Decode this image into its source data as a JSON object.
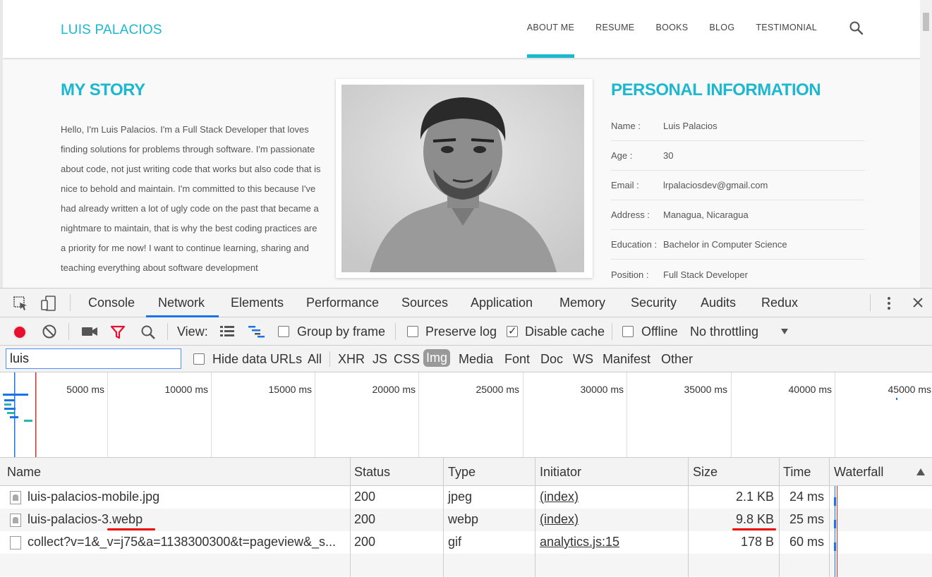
{
  "site": {
    "brand": "LUIS PALACIOS",
    "nav": [
      "ABOUT ME",
      "RESUME",
      "BOOKS",
      "BLOG",
      "TESTIMONIAL"
    ],
    "story_title": "MY STORY",
    "story_text": "Hello, I'm Luis Palacios. I'm a Full Stack Developer that loves finding solutions for problems through software. I'm passionate about code, not just writing code that works but also code that is nice to behold and maintain. I'm committed to this because I've had already written a lot of ugly code on the past that became a nightmare to maintain, that is why the best coding practices are a priority for me now! I want to continue learning, sharing and teaching everything about software development",
    "personal_title": "PERSONAL INFORMATION",
    "personal": [
      {
        "k": "Name :",
        "v": "Luis Palacios"
      },
      {
        "k": "Age :",
        "v": "30"
      },
      {
        "k": "Email :",
        "v": "lrpalaciosdev@gmail.com"
      },
      {
        "k": "Address :",
        "v": "Managua, Nicaragua"
      },
      {
        "k": "Education :",
        "v": "Bachelor in Computer Science"
      },
      {
        "k": "Position :",
        "v": "Full Stack Developer"
      }
    ]
  },
  "devtools": {
    "tabs": [
      "Console",
      "Network",
      "Elements",
      "Performance",
      "Sources",
      "Application",
      "Memory",
      "Security",
      "Audits",
      "Redux"
    ],
    "active_tab": "Network",
    "toolbar": {
      "view_label": "View:",
      "group_by_frame": "Group by frame",
      "preserve_log": "Preserve log",
      "disable_cache": "Disable cache",
      "offline": "Offline",
      "throttling": "No throttling"
    },
    "filter": {
      "value": "luis",
      "hide_data_urls": "Hide data URLs",
      "types": [
        "All",
        "XHR",
        "JS",
        "CSS",
        "Img",
        "Media",
        "Font",
        "Doc",
        "WS",
        "Manifest",
        "Other"
      ],
      "active_type": "Img"
    },
    "overview_ticks": [
      "5000 ms",
      "10000 ms",
      "15000 ms",
      "20000 ms",
      "25000 ms",
      "30000 ms",
      "35000 ms",
      "40000 ms",
      "45000 ms"
    ],
    "columns": [
      "Name",
      "Status",
      "Type",
      "Initiator",
      "Size",
      "Time",
      "Waterfall"
    ],
    "rows": [
      {
        "name": "luis-palacios-mobile.jpg",
        "status": "200",
        "type": "jpeg",
        "initiator": "(index)",
        "size": "2.1 KB",
        "time": "24 ms"
      },
      {
        "name": "luis-palacios-3.webp",
        "status": "200",
        "type": "webp",
        "initiator": "(index)",
        "size": "9.8 KB",
        "time": "25 ms"
      },
      {
        "name": "collect?v=1&_v=j75&a=1138300300&t=pageview&_s...",
        "status": "200",
        "type": "gif",
        "initiator": "analytics.js:15",
        "size": "178 B",
        "time": "60 ms"
      }
    ]
  }
}
